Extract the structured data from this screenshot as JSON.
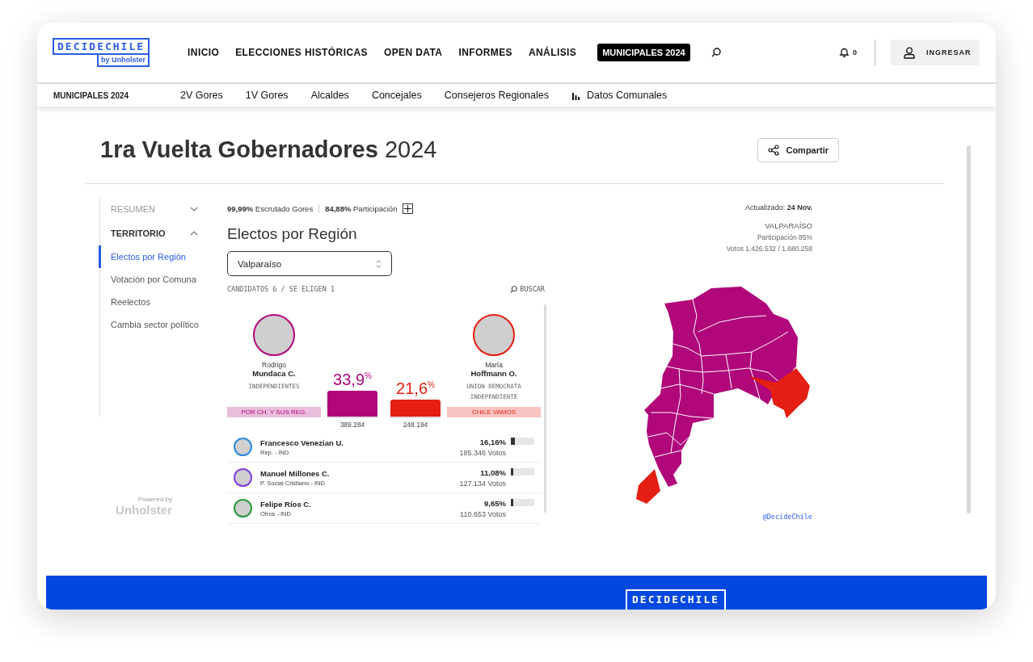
{
  "header": {
    "logo": {
      "name": "DECIDECHILE",
      "byline": "by Unholster"
    },
    "nav": [
      {
        "label": "INICIO",
        "kind": "link"
      },
      {
        "label": "ELECCIONES HISTÓRICAS",
        "kind": "link"
      },
      {
        "label": "OPEN DATA",
        "kind": "link"
      },
      {
        "label": "INFORMES",
        "kind": "link"
      },
      {
        "label": "ANÁLISIS",
        "kind": "link"
      },
      {
        "label": "MUNICIPALES 2024",
        "kind": "badge"
      }
    ],
    "notifications": "0",
    "login": "INGRESAR"
  },
  "subnav": {
    "title": "MUNICIPALES 2024",
    "items": [
      {
        "label": "2V Gores",
        "kind": "text"
      },
      {
        "label": "1V Gores",
        "kind": "text"
      },
      {
        "label": "Alcaldes",
        "kind": "text"
      },
      {
        "label": "Concejales",
        "kind": "text"
      },
      {
        "label": "Consejeros Regionales",
        "kind": "text"
      },
      {
        "label": "Datos Comunales",
        "kind": "chart"
      }
    ]
  },
  "page": {
    "title": "**1ra Vuelta Gobernadores** 2024",
    "share": "Compartir"
  },
  "sidebar": {
    "sections": [
      {
        "label": "RESUMEN",
        "expanded": false
      },
      {
        "label": "TERRITORIO",
        "expanded": true,
        "items": [
          {
            "label": "Electos por Región",
            "selected": true
          },
          {
            "label": "Votación por Comuna",
            "selected": false
          },
          {
            "label": "Reelectos",
            "selected": false
          },
          {
            "label": "Cambia sector político",
            "selected": false
          }
        ]
      }
    ]
  },
  "powered_by": {
    "label": "Powered by",
    "brand": "Unholster"
  },
  "stats": [
    "**99,99%** Escrutado Gores",
    "**84,88%** Participación"
  ],
  "heading": "Electos por Región",
  "region_select": "Valparaíso",
  "candidates_header": "CANDIDATOS 6 / SE ELIGEN 1",
  "search": "BUSCAR",
  "leaders": [
    {
      "first_name": "Rodrigo",
      "last_name": "Mundaca C.",
      "party": "INDEPENDIENTES",
      "pact": "POR CH. Y SUS REG.",
      "percent": "33,9$^{%}$",
      "level": 0.339,
      "votes": "389.284",
      "color": "#b0077a"
    },
    {
      "first_name": "María",
      "last_name": "Hoffmann O.",
      "party": "UNION DEMOCRATA INDEPENDIENTE",
      "pact": "CHILE VAMOS",
      "percent": "21,6$^{%}$",
      "level": 0.216,
      "votes": "248.194",
      "color": "#e41e12"
    }
  ],
  "others": [
    {
      "name": "Francesco Venezian U.",
      "party": "Rep. - IND",
      "percent": "16,16%",
      "votes": "185.346 Votos",
      "level": 0.16,
      "color": "#2a8ae0"
    },
    {
      "name": "Manuel Millones C.",
      "party": "P. Social Cristiano - IND",
      "percent": "11,08%",
      "votes": "127.134 Votos",
      "level": 0.11,
      "color": "#7b3fe0"
    },
    {
      "name": "Felipe Ríos C.",
      "party": "Otros - IND",
      "percent": "9,65%",
      "votes": "110.653 Votos",
      "level": 0.1,
      "color": "#2a9a3a"
    }
  ],
  "map": {
    "updated": "Actualizado: **24 Nov.**",
    "region": "VALPARAÍSO",
    "participation": "Participación 85%",
    "votes": "Votos 1.426.532 / 1.680.258",
    "credit": "@DecideChile"
  },
  "banner": {
    "logo": "DECIDECHILE"
  }
}
